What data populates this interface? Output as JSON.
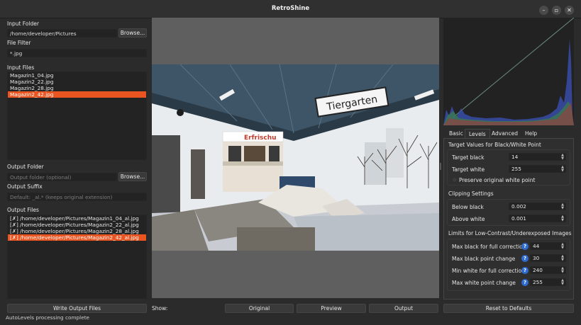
{
  "window": {
    "title": "RetroShine"
  },
  "left": {
    "input_folder_label": "Input Folder",
    "input_folder_value": "/home/developer/Pictures",
    "browse_label": "Browse...",
    "file_filter_label": "File Filter",
    "file_filter_value": "*.jpg",
    "input_files_label": "Input Files",
    "input_files": [
      "Magazin1_04.jpg",
      "Magazin2_22.jpg",
      "Magazin2_28.jpg",
      "Magazin2_42.jpg"
    ],
    "output_folder_label": "Output Folder",
    "output_folder_placeholder": "Output folder (optional)",
    "output_browse_label": "Browse...",
    "output_suffix_label": "Output Suffix",
    "output_suffix_placeholder": "Default: _al.* (keeps original extension)",
    "output_files_label": "Output Files",
    "output_files": [
      "[✗] /home/developer/Pictures/Magazin1_04_al.jpg",
      "[✗] /home/developer/Pictures/Magazin2_22_al.jpg",
      "[✗] /home/developer/Pictures/Magazin2_28_al.jpg",
      "[✗] /home/developer/Pictures/Magazin2_42_al.jpg"
    ],
    "write_button": "Write Output Files"
  },
  "center": {
    "show_label": "Show:",
    "view_buttons": [
      "Original",
      "Preview",
      "Output"
    ],
    "sign_text": "Tiergarten",
    "kiosk_text": "Erfrischu"
  },
  "right": {
    "tabs": [
      "Basic",
      "Levels",
      "Advanced",
      "Help"
    ],
    "active_tab": "Levels",
    "section_targets": "Target Values for Black/White Point",
    "target_black_label": "Target black",
    "target_black_value": "14",
    "target_white_label": "Target white",
    "target_white_value": "255",
    "preserve_label": "Preserve original white point",
    "section_clipping": "Clipping Settings",
    "below_black_label": "Below black",
    "below_black_value": "0.002",
    "above_white_label": "Above white",
    "above_white_value": "0.001",
    "section_limits": "Limits for Low-Contrast/Underexposed Images",
    "limits": [
      {
        "label": "Max black for full correction",
        "value": "44"
      },
      {
        "label": "Max black point change",
        "value": "30"
      },
      {
        "label": "Min white for full correction",
        "value": "240"
      },
      {
        "label": "Max white point change",
        "value": "255"
      }
    ],
    "help_glyph": "?",
    "reset_button": "Reset to Defaults"
  },
  "status": {
    "text": "AutoLevels processing complete"
  },
  "colors": {
    "accent": "#e95420",
    "help": "#2e6bd1"
  }
}
